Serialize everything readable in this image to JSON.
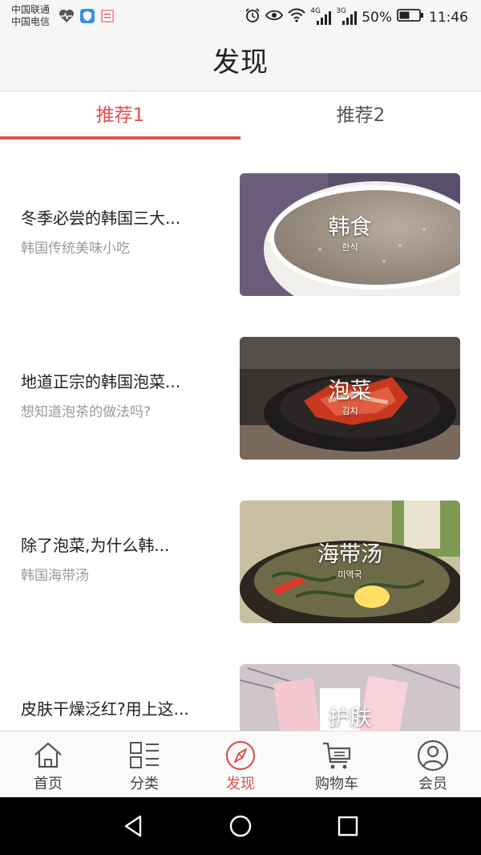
{
  "status_bar": {
    "carrier_1": "中国联通",
    "carrier_2": "中国电信",
    "network_1": "4G",
    "network_2": "3G",
    "battery": "50%",
    "time": "11:46",
    "icons": [
      "heart-pulse-icon",
      "shield-app-icon",
      "card-app-icon",
      "alarm-icon",
      "eye-icon",
      "wifi-icon",
      "signal-icon",
      "battery-icon"
    ]
  },
  "header": {
    "title": "发现"
  },
  "tabs": [
    {
      "label": "推荐1",
      "active": true
    },
    {
      "label": "推荐2",
      "active": false
    }
  ],
  "feed": [
    {
      "title": "冬季必尝的韩国三大...",
      "subtitle": "韩国传统美味小吃",
      "image_caption": "韩食",
      "image_subcaption": "한식"
    },
    {
      "title": "地道正宗的韩国泡菜...",
      "subtitle": "想知道泡茶的做法吗?",
      "image_caption": "泡菜",
      "image_subcaption": "김치"
    },
    {
      "title": "除了泡菜,为什么韩...",
      "subtitle": "韩国海带汤",
      "image_caption": "海带汤",
      "image_subcaption": "미역국"
    },
    {
      "title": "皮肤干燥泛红?用上这...",
      "subtitle": "",
      "image_caption": "护肤",
      "image_subcaption": ""
    }
  ],
  "bottom_nav": [
    {
      "label": "首页",
      "icon": "home-icon",
      "active": false
    },
    {
      "label": "分类",
      "icon": "category-grid-icon",
      "active": false
    },
    {
      "label": "发现",
      "icon": "compass-icon",
      "active": true
    },
    {
      "label": "购物车",
      "icon": "cart-icon",
      "active": false
    },
    {
      "label": "会员",
      "icon": "user-icon",
      "active": false
    }
  ],
  "colors": {
    "accent": "#e0514f",
    "text": "#222222",
    "subtext": "#9a9a9a",
    "bar_bg": "#f6f6f6"
  }
}
